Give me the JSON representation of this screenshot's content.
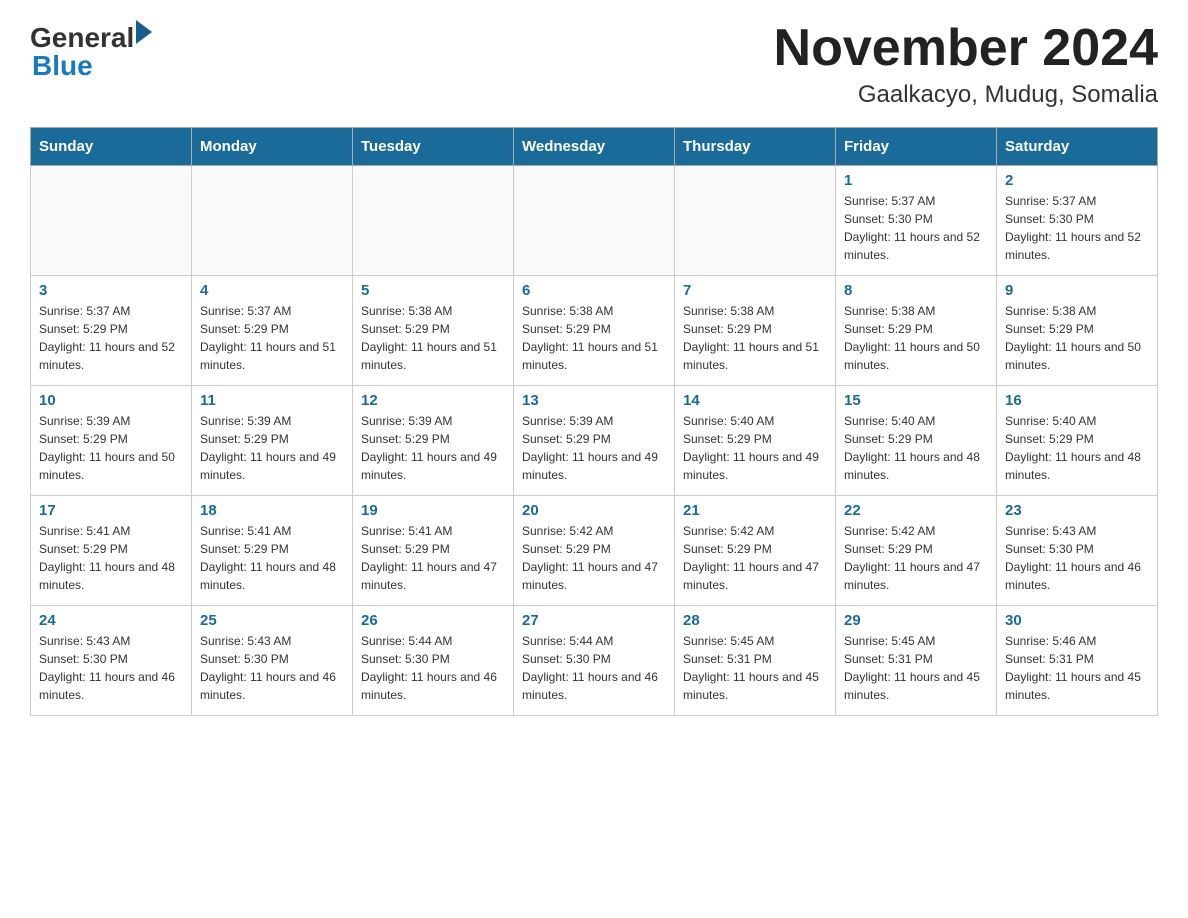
{
  "header": {
    "logo_general": "General",
    "logo_blue": "Blue",
    "title": "November 2024",
    "subtitle": "Gaalkacyo, Mudug, Somalia"
  },
  "calendar": {
    "days_of_week": [
      "Sunday",
      "Monday",
      "Tuesday",
      "Wednesday",
      "Thursday",
      "Friday",
      "Saturday"
    ],
    "weeks": [
      [
        {
          "day": "",
          "info": ""
        },
        {
          "day": "",
          "info": ""
        },
        {
          "day": "",
          "info": ""
        },
        {
          "day": "",
          "info": ""
        },
        {
          "day": "",
          "info": ""
        },
        {
          "day": "1",
          "info": "Sunrise: 5:37 AM\nSunset: 5:30 PM\nDaylight: 11 hours and 52 minutes."
        },
        {
          "day": "2",
          "info": "Sunrise: 5:37 AM\nSunset: 5:30 PM\nDaylight: 11 hours and 52 minutes."
        }
      ],
      [
        {
          "day": "3",
          "info": "Sunrise: 5:37 AM\nSunset: 5:29 PM\nDaylight: 11 hours and 52 minutes."
        },
        {
          "day": "4",
          "info": "Sunrise: 5:37 AM\nSunset: 5:29 PM\nDaylight: 11 hours and 51 minutes."
        },
        {
          "day": "5",
          "info": "Sunrise: 5:38 AM\nSunset: 5:29 PM\nDaylight: 11 hours and 51 minutes."
        },
        {
          "day": "6",
          "info": "Sunrise: 5:38 AM\nSunset: 5:29 PM\nDaylight: 11 hours and 51 minutes."
        },
        {
          "day": "7",
          "info": "Sunrise: 5:38 AM\nSunset: 5:29 PM\nDaylight: 11 hours and 51 minutes."
        },
        {
          "day": "8",
          "info": "Sunrise: 5:38 AM\nSunset: 5:29 PM\nDaylight: 11 hours and 50 minutes."
        },
        {
          "day": "9",
          "info": "Sunrise: 5:38 AM\nSunset: 5:29 PM\nDaylight: 11 hours and 50 minutes."
        }
      ],
      [
        {
          "day": "10",
          "info": "Sunrise: 5:39 AM\nSunset: 5:29 PM\nDaylight: 11 hours and 50 minutes."
        },
        {
          "day": "11",
          "info": "Sunrise: 5:39 AM\nSunset: 5:29 PM\nDaylight: 11 hours and 49 minutes."
        },
        {
          "day": "12",
          "info": "Sunrise: 5:39 AM\nSunset: 5:29 PM\nDaylight: 11 hours and 49 minutes."
        },
        {
          "day": "13",
          "info": "Sunrise: 5:39 AM\nSunset: 5:29 PM\nDaylight: 11 hours and 49 minutes."
        },
        {
          "day": "14",
          "info": "Sunrise: 5:40 AM\nSunset: 5:29 PM\nDaylight: 11 hours and 49 minutes."
        },
        {
          "day": "15",
          "info": "Sunrise: 5:40 AM\nSunset: 5:29 PM\nDaylight: 11 hours and 48 minutes."
        },
        {
          "day": "16",
          "info": "Sunrise: 5:40 AM\nSunset: 5:29 PM\nDaylight: 11 hours and 48 minutes."
        }
      ],
      [
        {
          "day": "17",
          "info": "Sunrise: 5:41 AM\nSunset: 5:29 PM\nDaylight: 11 hours and 48 minutes."
        },
        {
          "day": "18",
          "info": "Sunrise: 5:41 AM\nSunset: 5:29 PM\nDaylight: 11 hours and 48 minutes."
        },
        {
          "day": "19",
          "info": "Sunrise: 5:41 AM\nSunset: 5:29 PM\nDaylight: 11 hours and 47 minutes."
        },
        {
          "day": "20",
          "info": "Sunrise: 5:42 AM\nSunset: 5:29 PM\nDaylight: 11 hours and 47 minutes."
        },
        {
          "day": "21",
          "info": "Sunrise: 5:42 AM\nSunset: 5:29 PM\nDaylight: 11 hours and 47 minutes."
        },
        {
          "day": "22",
          "info": "Sunrise: 5:42 AM\nSunset: 5:29 PM\nDaylight: 11 hours and 47 minutes."
        },
        {
          "day": "23",
          "info": "Sunrise: 5:43 AM\nSunset: 5:30 PM\nDaylight: 11 hours and 46 minutes."
        }
      ],
      [
        {
          "day": "24",
          "info": "Sunrise: 5:43 AM\nSunset: 5:30 PM\nDaylight: 11 hours and 46 minutes."
        },
        {
          "day": "25",
          "info": "Sunrise: 5:43 AM\nSunset: 5:30 PM\nDaylight: 11 hours and 46 minutes."
        },
        {
          "day": "26",
          "info": "Sunrise: 5:44 AM\nSunset: 5:30 PM\nDaylight: 11 hours and 46 minutes."
        },
        {
          "day": "27",
          "info": "Sunrise: 5:44 AM\nSunset: 5:30 PM\nDaylight: 11 hours and 46 minutes."
        },
        {
          "day": "28",
          "info": "Sunrise: 5:45 AM\nSunset: 5:31 PM\nDaylight: 11 hours and 45 minutes."
        },
        {
          "day": "29",
          "info": "Sunrise: 5:45 AM\nSunset: 5:31 PM\nDaylight: 11 hours and 45 minutes."
        },
        {
          "day": "30",
          "info": "Sunrise: 5:46 AM\nSunset: 5:31 PM\nDaylight: 11 hours and 45 minutes."
        }
      ]
    ]
  }
}
